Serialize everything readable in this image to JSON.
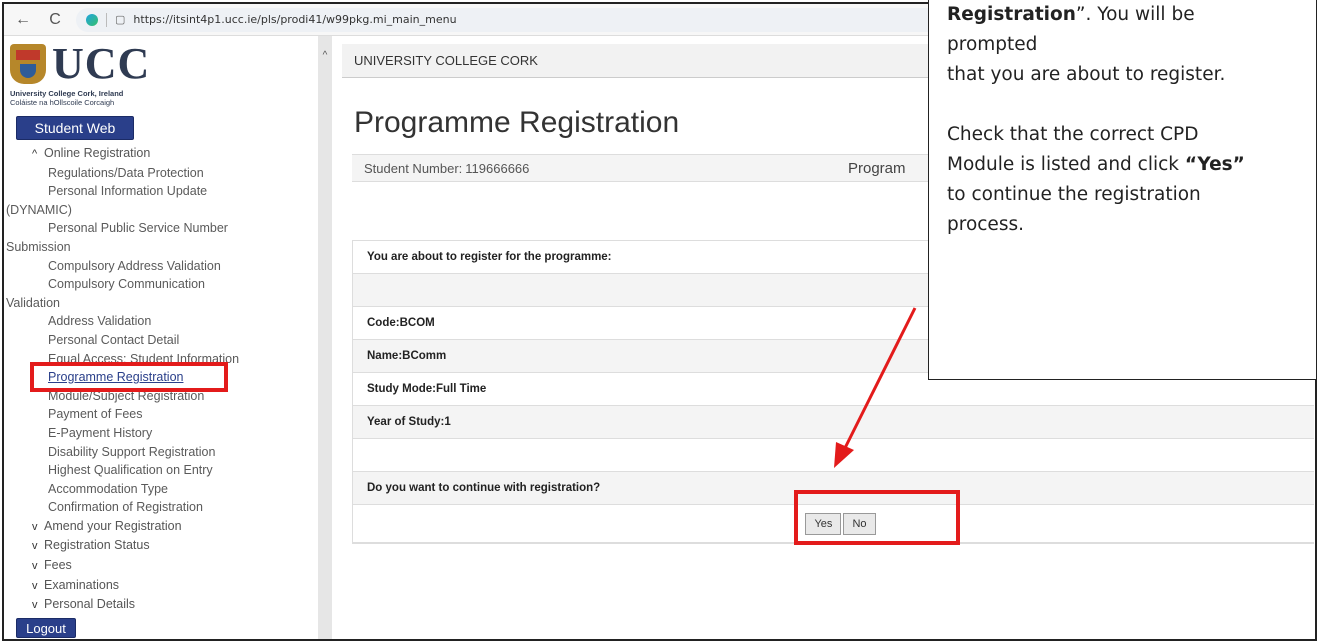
{
  "browser": {
    "url": "https://itsint4p1.ucc.ie/pls/prodi41/w99pkg.mi_main_menu"
  },
  "logo": {
    "title": "UCC",
    "line1": "University College Cork, Ireland",
    "line2": "Coláiste na hOllscoile Corcaigh"
  },
  "sidebar": {
    "student_web": "Student Web",
    "logout": "Logout",
    "items": [
      {
        "type": "section",
        "label": "Online Registration"
      },
      {
        "type": "item",
        "label": "Regulations/Data Protection"
      },
      {
        "type": "item",
        "label": "Personal Information Update"
      },
      {
        "type": "cont",
        "label": "(DYNAMIC)"
      },
      {
        "type": "item",
        "label": "Personal Public Service Number"
      },
      {
        "type": "cont",
        "label": "Submission"
      },
      {
        "type": "item",
        "label": "Compulsory Address Validation"
      },
      {
        "type": "item",
        "label": "Compulsory Communication"
      },
      {
        "type": "cont",
        "label": "Validation"
      },
      {
        "type": "item",
        "label": "Address Validation"
      },
      {
        "type": "item",
        "label": "Personal Contact Detail"
      },
      {
        "type": "item",
        "label": "Equal Access: Student Information"
      },
      {
        "type": "active",
        "label": "Programme Registration"
      },
      {
        "type": "item",
        "label": "Module/Subject Registration"
      },
      {
        "type": "item",
        "label": "Payment of Fees"
      },
      {
        "type": "item",
        "label": "E-Payment History"
      },
      {
        "type": "item",
        "label": "Disability Support Registration"
      },
      {
        "type": "item",
        "label": "Highest Qualification on Entry"
      },
      {
        "type": "item",
        "label": "Accommodation Type"
      },
      {
        "type": "item",
        "label": "Confirmation of Registration"
      },
      {
        "type": "collapsed",
        "label": "Amend your Registration"
      },
      {
        "type": "collapsed",
        "label": "Registration Status"
      },
      {
        "type": "collapsed",
        "label": "Fees"
      },
      {
        "type": "collapsed",
        "label": "Examinations"
      },
      {
        "type": "collapsed",
        "label": "Personal Details"
      }
    ]
  },
  "main": {
    "univ_bar": "UNIVERSITY COLLEGE CORK",
    "title": "Programme Registration",
    "student_number_label": "Student Number:",
    "student_number": "119666666",
    "info_right": "Program",
    "rows": {
      "intro": "You are about to register for the programme:",
      "code": "Code:BCOM",
      "name": "Name:BComm",
      "mode": "Study Mode:Full Time",
      "year": "Year of Study:1",
      "question": "Do you want to continue with registration?"
    },
    "yes": "Yes",
    "no": "No"
  },
  "callout": {
    "l1_bold": "Registration",
    "l1_rest": "”. You will be",
    "l2": "prompted",
    "l3": "that you are about to register.",
    "l4": "Check that the correct CPD",
    "l5_pre": "Module is listed and click ",
    "l5_bold": "“Yes”",
    "l6": "to continue the registration",
    "l7": "process."
  },
  "colors": {
    "highlight": "#e31b1b",
    "brand": "#2a3f8a"
  }
}
